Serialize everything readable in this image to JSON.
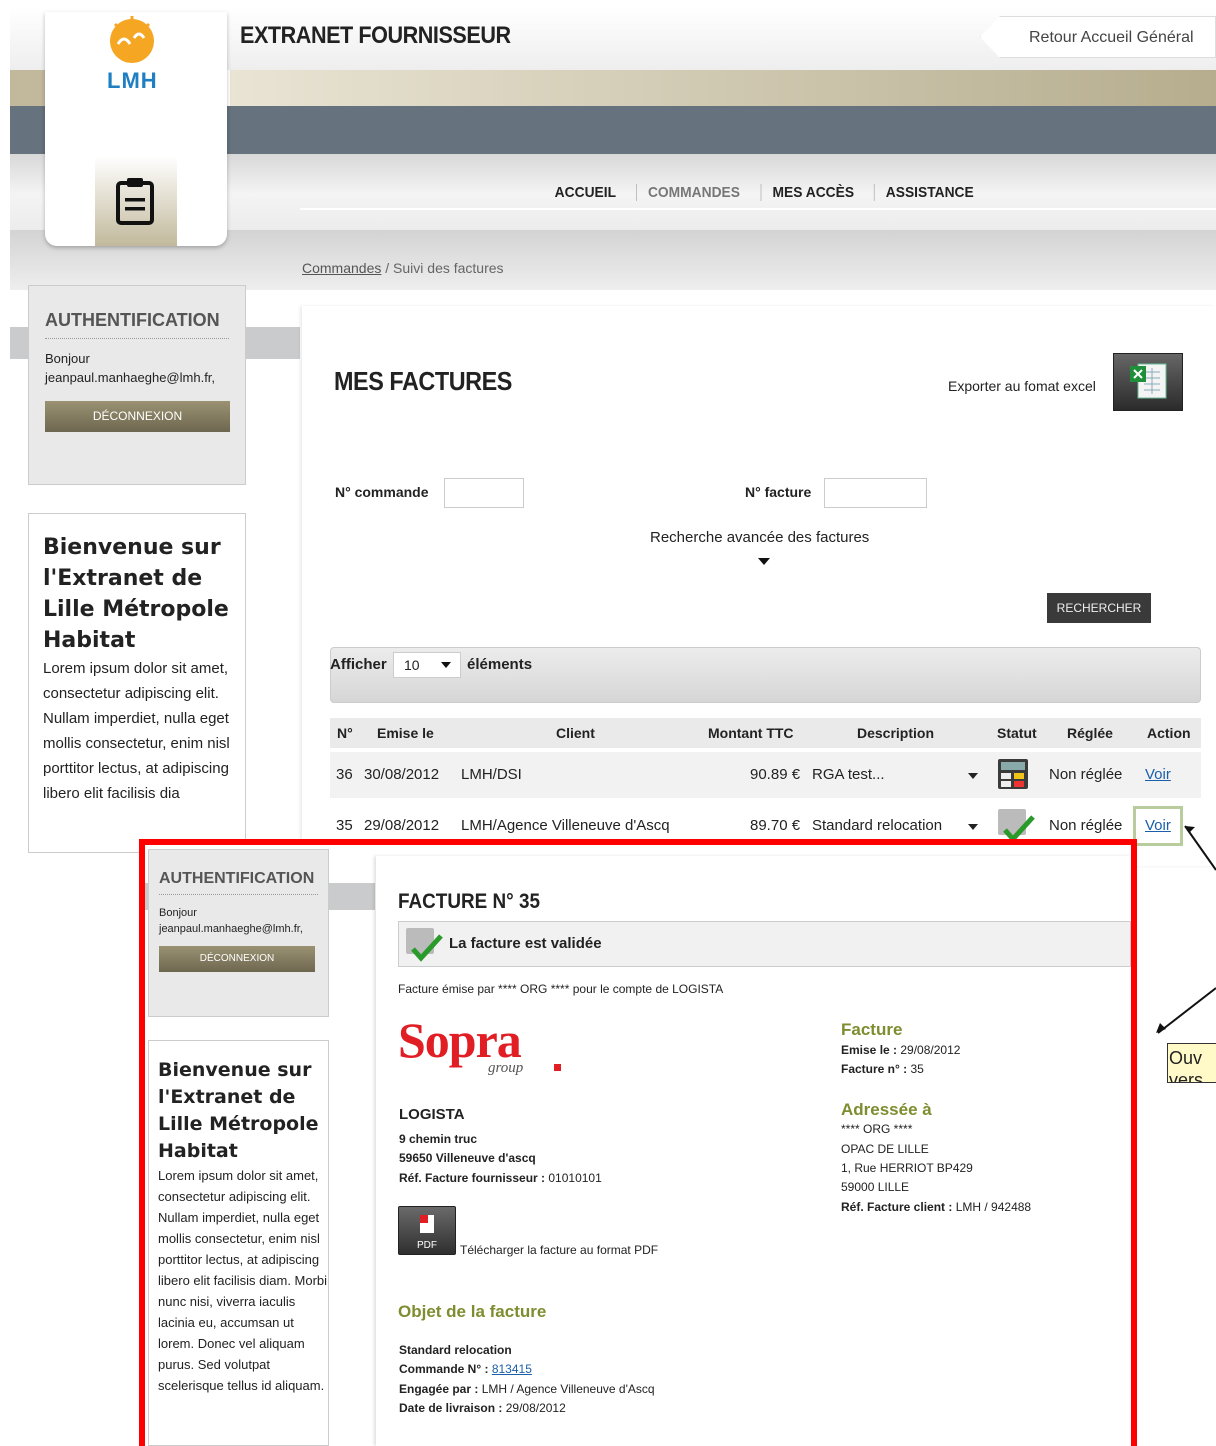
{
  "header": {
    "site_title": "EXTRANET FOURNISSEUR",
    "logo_text": "LMH",
    "retour": "Retour Accueil Général",
    "nav": [
      "ACCUEIL",
      "COMMANDES",
      "MES ACCÈS",
      "ASSISTANCE"
    ]
  },
  "breadcrumb": {
    "link": "Commandes",
    "rest": " / Suivi des factures"
  },
  "sidebar": {
    "auth_title": "AUTHENTIFICATION",
    "greeting": "Bonjour",
    "email": "jeanpaul.manhaeghe@lmh.fr,",
    "logout": "DÉCONNEXION",
    "welcome_title": "Bienvenue sur l'Extranet de Lille Métropole Habitat",
    "welcome_text": "Lorem ipsum dolor sit amet, consectetur adipiscing elit. Nullam imperdiet, nulla eget mollis consectetur, enim nisl porttitor lectus, at adipiscing libero elit facilisis diam. Morbi nunc nisi, viverra iaculis lacinia eu, accumsan ut lorem. Donec vel aliquam purus. Sed volutpat scelerisque tellus id aliquam.",
    "welcome_text_clipped": "Lorem ipsum dolor sit amet, consectetur adipiscing elit. Nullam imperdiet, nulla eget mollis consectetur, enim nisl porttitor lectus, at adipiscing libero elit facilisis dia"
  },
  "factures": {
    "title": "MES FACTURES",
    "export_label": "Exporter au fomat excel",
    "cmd_label": "N° commande",
    "fac_label": "N° facture",
    "advanced": "Recherche avancée des factures",
    "search_btn": "RECHERCHER",
    "show_label": "Afficher",
    "show_value": "10",
    "show_suffix": "éléments",
    "columns": [
      "N°",
      "Emise le",
      "Client",
      "Montant TTC",
      "Description",
      "Statut",
      "Réglée",
      "Action"
    ],
    "rows": [
      {
        "num": "36",
        "date": "30/08/2012",
        "client": "LMH/DSI",
        "amount": "90.89 €",
        "desc": "RGA test...",
        "paid": "Non réglée",
        "action": "Voir"
      },
      {
        "num": "35",
        "date": "29/08/2012",
        "client": "LMH/Agence Villeneuve d'Ascq",
        "amount": "89.70 €",
        "desc": "Standard relocation",
        "paid": "Non réglée",
        "action": "Voir"
      }
    ]
  },
  "detail": {
    "title": "FACTURE N° 35",
    "status": "La facture est validée",
    "emise_par": "Facture émise par **** ORG **** pour le compte de LOGISTA",
    "brand": "Sopra",
    "brand_sub": "group",
    "supplier_name": "LOGISTA",
    "supplier_street": "9 chemin truc",
    "supplier_city": "59650 Villeneuve d'ascq",
    "ref_fourn_label": "Réf. Facture fournisseur :",
    "ref_fourn": "01010101",
    "pdf_icon": "PDF",
    "pdf_label": "Télécharger la facture au format PDF",
    "facture_h": "Facture",
    "emise_label": "Emise le :",
    "emise_value": "29/08/2012",
    "num_label": "Facture n° :",
    "num_value": "35",
    "adressee_h": "Adressée à",
    "addr1": "**** ORG ****",
    "addr2": "OPAC DE LILLE",
    "addr3": "1, Rue HERRIOT BP429",
    "addr4": "59000 LILLE",
    "ref_client_label": "Réf. Facture client :",
    "ref_client": "LMH / 942488",
    "objet_h": "Objet de la facture",
    "objet": "Standard relocation",
    "commande_label": "Commande N° :",
    "commande": "813415",
    "engagee_label": "Engagée par :",
    "engagee": "LMH / Agence Villeneuve d'Ascq",
    "livraison_label": "Date de livraison :",
    "livraison": "29/08/2012"
  },
  "callout": {
    "line1": "Ouv",
    "line2": "vers"
  },
  "colors": {
    "highlight_red": "#ff0000",
    "accent_green": "#7d8d2f",
    "link_blue": "#1a5fa8",
    "brand_red": "#e01e24"
  }
}
